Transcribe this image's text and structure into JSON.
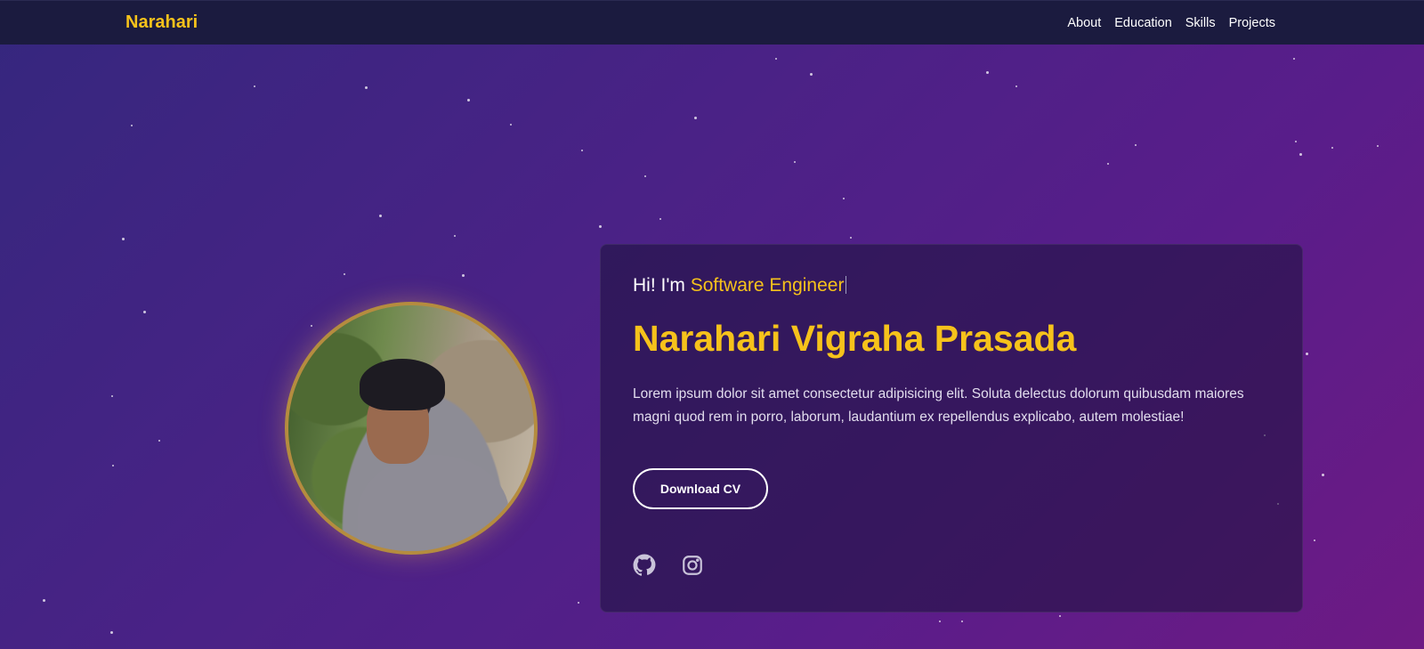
{
  "nav": {
    "brand": "Narahari",
    "links": [
      "About",
      "Education",
      "Skills",
      "Projects"
    ]
  },
  "hero": {
    "greeting": "Hi! I'm",
    "role": "Software Engineer",
    "name": "Narahari Vigraha Prasada",
    "description": "Lorem ipsum dolor sit amet consectetur adipisicing elit. Soluta delectus dolorum quibusdam maiores magni quod rem in porro, laborum, laudantium ex repellendus explicabo, autem molestiae!",
    "cv_button": "Download CV"
  },
  "social": {
    "icons": [
      "github-icon",
      "instagram-icon"
    ]
  },
  "colors": {
    "accent": "#f6c21b",
    "navbar": "#1b1b3f"
  }
}
